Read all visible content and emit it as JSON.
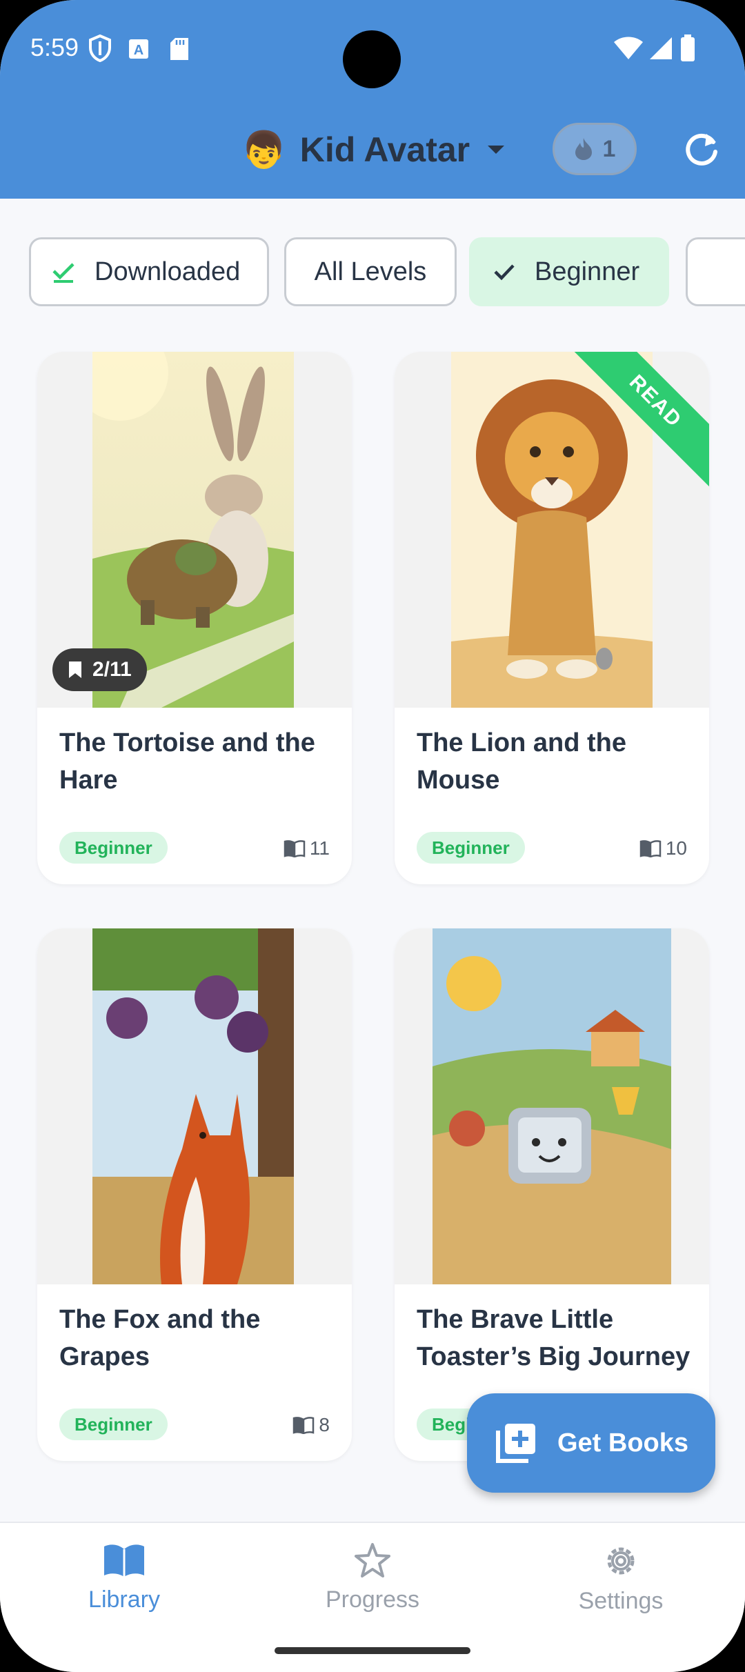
{
  "status_bar": {
    "time": "5:59"
  },
  "header": {
    "kid_emoji": "👦",
    "kid_name": "Kid Avatar",
    "streak_count": "1",
    "refresh_icon": "refresh-icon"
  },
  "filters": [
    {
      "label": "Downloaded",
      "selected": false,
      "icon": "check-icon"
    },
    {
      "label": "All Levels",
      "selected": false
    },
    {
      "label": "Beginner",
      "selected": true,
      "icon": "check-icon"
    }
  ],
  "books": [
    {
      "title": "The Tortoise and the Hare",
      "level": "Beginner",
      "pages": "11",
      "progress": "2/11",
      "read": false
    },
    {
      "title": "The Lion and the Mouse",
      "level": "Beginner",
      "pages": "10",
      "read": true,
      "read_label": "READ"
    },
    {
      "title": "The Fox and the Grapes",
      "level": "Beginner",
      "pages": "8",
      "read": false
    },
    {
      "title": "The Brave Little Toaster’s Big Journey",
      "level": "Beginner",
      "read": false
    }
  ],
  "fab": {
    "label": "Get Books"
  },
  "nav": [
    {
      "label": "Library",
      "active": true,
      "icon": "book-open-icon"
    },
    {
      "label": "Progress",
      "active": false,
      "icon": "star-icon"
    },
    {
      "label": "Settings",
      "active": false,
      "icon": "gear-icon"
    }
  ],
  "colors": {
    "primary": "#4a8ed9",
    "accent_green": "#2ecc71",
    "badge_bg": "#d9f6e4"
  }
}
